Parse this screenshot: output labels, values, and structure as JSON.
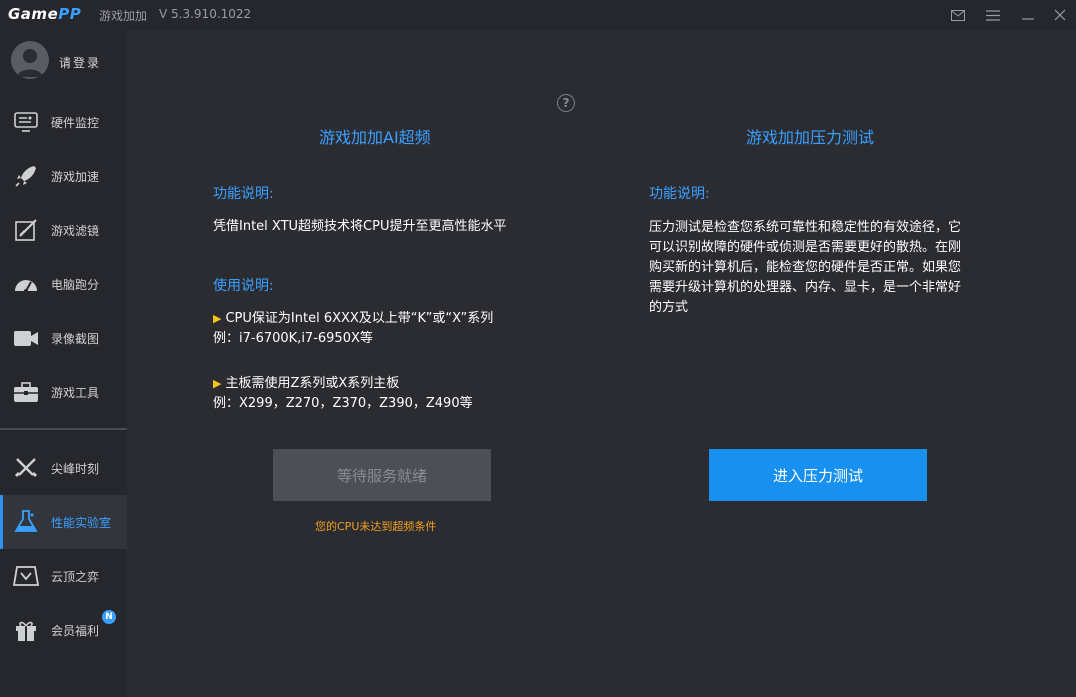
{
  "app": {
    "logo_main": "Game",
    "logo_accent": "PP",
    "subtitle": "游戏加加",
    "version": "V 5.3.910.1022"
  },
  "window_controls": [
    "mail-icon",
    "skin-icon",
    "menu-icon",
    "minimize-icon",
    "close-icon"
  ],
  "sidebar": {
    "login": "请登录",
    "items": [
      {
        "label": "硬件监控",
        "icon": "hardware-monitor-icon"
      },
      {
        "label": "游戏加速",
        "icon": "rocket-icon"
      },
      {
        "label": "游戏滤镜",
        "icon": "filter-icon"
      },
      {
        "label": "电脑跑分",
        "icon": "speedometer-icon"
      },
      {
        "label": "录像截图",
        "icon": "camera-icon"
      },
      {
        "label": "游戏工具",
        "icon": "toolbox-icon"
      },
      {
        "label": "尖峰时刻",
        "icon": "crossed-swords-icon"
      },
      {
        "label": "性能实验室",
        "icon": "flask-icon",
        "active": true
      },
      {
        "label": "云顶之弈",
        "icon": "chess-icon"
      },
      {
        "label": "会员福利",
        "icon": "gift-icon",
        "badge": "N"
      }
    ]
  },
  "main": {
    "help_label": "?",
    "left": {
      "title": "游戏加加AI超频",
      "func_label": "功能说明:",
      "func_text": "凭借Intel XTU超频技术将CPU提升至更高性能水平",
      "usage_label": "使用说明:",
      "req1_line1": "CPU保证为Intel 6XXX及以上带“K”或“X”系列",
      "req1_line2": "例：i7-6700K,i7-6950X等",
      "req2_line1": "主板需使用Z系列或X系列主板",
      "req2_line2": "例：X299，Z270，Z370，Z390，Z490等",
      "button": "等待服务就绪",
      "warning": "您的CPU未达到超频条件"
    },
    "right": {
      "title": "游戏加加压力测试",
      "func_label": "功能说明:",
      "desc_lines": [
        "压力测试是检查您系统可靠性和稳定性的有效途径，它",
        "可以识别故障的硬件或侦测是否需要更好的散热。在刚",
        "购买新的计算机后，能检查您的硬件是否正常。如果您",
        "需要升级计算机的处理器、内存、显卡，是一个非常好",
        "的方式"
      ],
      "button": "进入压力测试"
    }
  },
  "colors": {
    "accent": "#3aa0ff",
    "primary_button": "#1890f0",
    "warning": "#f0a020",
    "bullet": "#f5c518"
  }
}
